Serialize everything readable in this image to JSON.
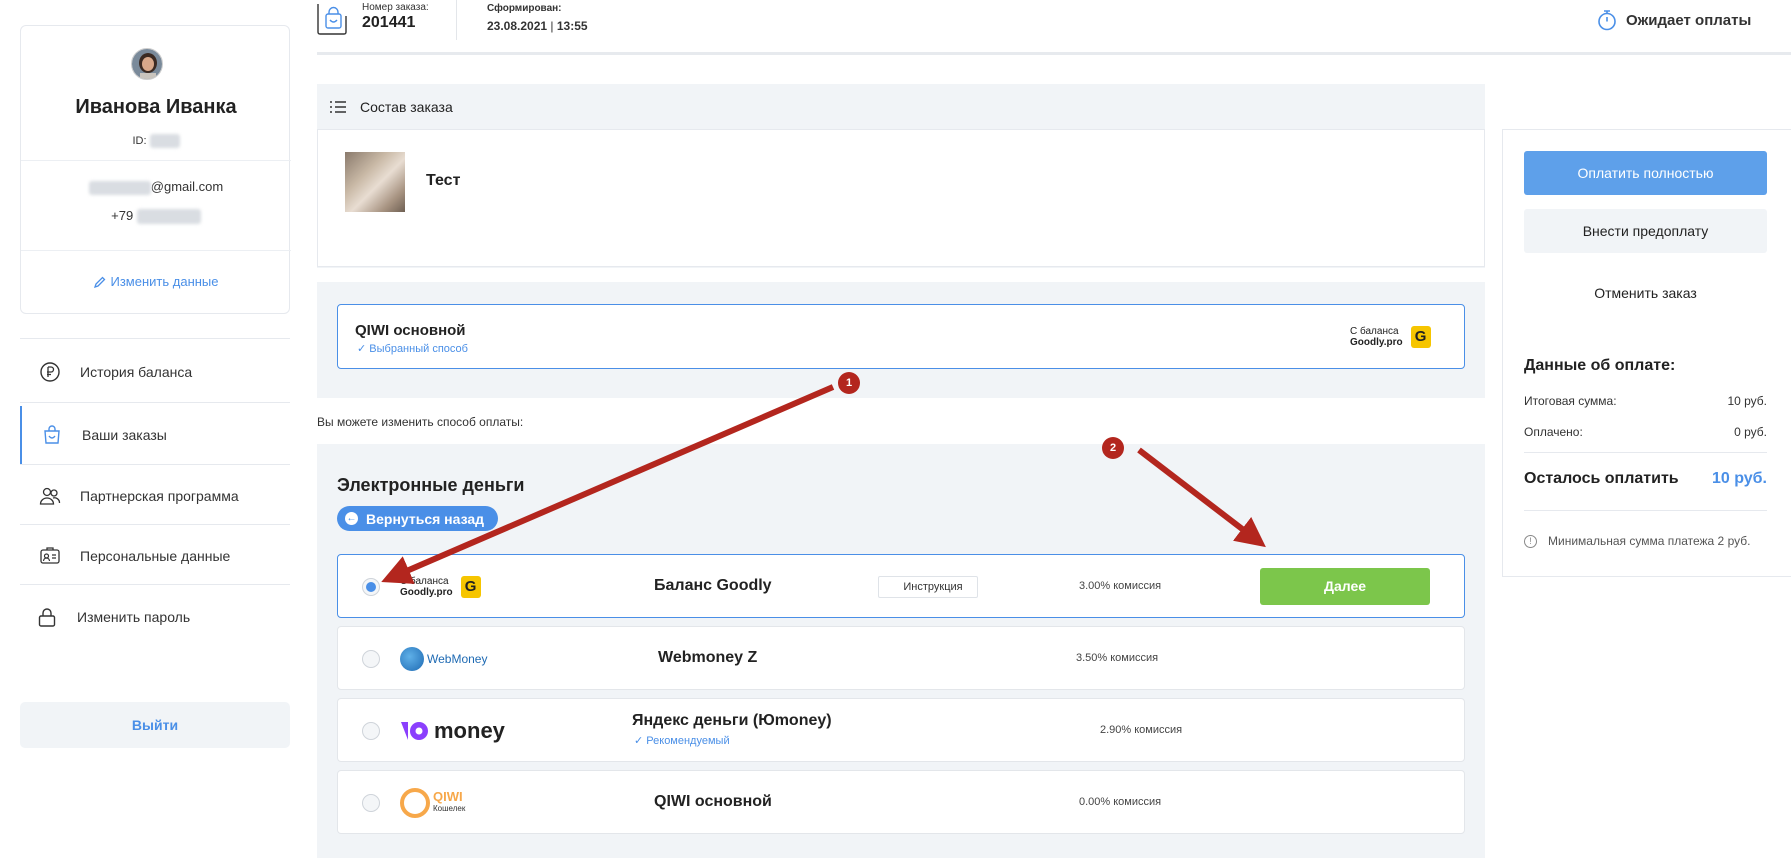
{
  "profile": {
    "name": "Иванова Иванка",
    "id_label": "ID:",
    "email_domain": "@gmail.com",
    "phone_prefix": "+79",
    "edit_label": "Изменить данные"
  },
  "nav": {
    "items": [
      {
        "label": "История баланса",
        "icon": "ruble-icon"
      },
      {
        "label": "Ваши заказы",
        "icon": "shopping-bag-icon"
      },
      {
        "label": "Партнерская программа",
        "icon": "people-icon"
      },
      {
        "label": "Персональные данные",
        "icon": "id-card-icon"
      },
      {
        "label": "Изменить пароль",
        "icon": "lock-icon"
      }
    ],
    "logout_label": "Выйти"
  },
  "header": {
    "order_number_label": "Номер заказа:",
    "order_number": "201441",
    "formed_label": "Сформирован:",
    "formed_date": "23.08.2021",
    "formed_separator": " | ",
    "formed_time": "13:55",
    "status": "Ожидает оплаты"
  },
  "composition": {
    "title": "Состав заказа",
    "product_name": "Тест"
  },
  "selected_method": {
    "name": "QIWI основной",
    "tag": "Выбранный способ",
    "balance_line1": "С баланса",
    "balance_line2": "Goodly.pro",
    "badge_letter": "G"
  },
  "change_note": "Вы можете изменить способ оплаты:",
  "emoney": {
    "title": "Электронные деньги",
    "back_label": "Вернуться назад",
    "methods": [
      {
        "name": "Баланс Goodly",
        "fee": "3.00% комиссия",
        "logo_line1": "С баланса",
        "logo_line2": "Goodly.pro",
        "badge_letter": "G",
        "instruction": "Инструкция",
        "next": "Далее",
        "selected": true
      },
      {
        "name": "Webmoney Z",
        "fee": "3.50% комиссия",
        "logo_text": "WebMoney"
      },
      {
        "name": "Яндекс деньги (Юmoney)",
        "fee": "2.90% комиссия",
        "logo_text": "money",
        "recommended": "Рекомендуемый"
      },
      {
        "name": "QIWI основной",
        "fee": "0.00% комиссия",
        "logo_text": "QIWI",
        "logo_sub": "Кошелек"
      }
    ]
  },
  "payment": {
    "pay_full": "Оплатить полностью",
    "prepay": "Внести предоплату",
    "cancel": "Отменить заказ",
    "details_title": "Данные об оплате:",
    "total_label": "Итоговая сумма:",
    "total_value": "10 руб.",
    "paid_label": "Оплачено:",
    "paid_value": "0 руб.",
    "remaining_label": "Осталось оплатить",
    "remaining_value": "10 руб.",
    "min_note": "Минимальная сумма платежа 2 руб."
  },
  "annotations": {
    "marker1": "1",
    "marker2": "2"
  },
  "colors": {
    "accent": "#4a8fe7",
    "next_button": "#7cc64b",
    "annotation": "#b3261e",
    "panel_bg": "#f1f4f7"
  }
}
